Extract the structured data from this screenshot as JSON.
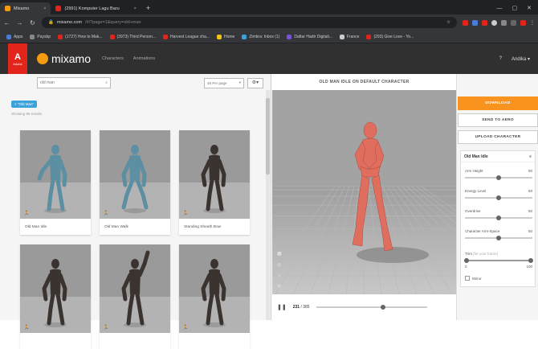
{
  "browser": {
    "tabs": [
      {
        "title": "Mixamo",
        "color": "#f39c12",
        "active": true
      },
      {
        "title": "(2991) Komputer Lagu Baru",
        "color": "#e1251b",
        "active": false
      }
    ],
    "url_host": "mixamo.com",
    "url_path": "/#/?page=1&query=old+man",
    "bookmarks": [
      {
        "label": "Apps",
        "color": "#4a7bd8"
      },
      {
        "label": "Paysbp",
        "color": "#888888"
      },
      {
        "label": "(1727) How to Mak...",
        "color": "#e1251b"
      },
      {
        "label": "(3973) Third Person...",
        "color": "#e1251b"
      },
      {
        "label": "Harvest League cha...",
        "color": "#e1251b"
      },
      {
        "label": "Home",
        "color": "#f1c40f"
      },
      {
        "label": "Zimbra: Inbox (1)",
        "color": "#3aa3db"
      },
      {
        "label": "Daftar Hadir Digitali...",
        "color": "#7b4fd8"
      },
      {
        "label": "France",
        "color": "#cccccc"
      },
      {
        "label": "(293) Give Love - Yo...",
        "color": "#e1251b"
      }
    ]
  },
  "app": {
    "adobe": "A",
    "adobe_sub": "Adobe",
    "logo": "mixamo",
    "nav": [
      "Characters",
      "Animations"
    ],
    "help": "?",
    "user": "Andika ▾"
  },
  "search": {
    "query": "old man",
    "per_page": "48 Per page",
    "tag": "× \"Old Man\"",
    "results": "Showing 96 results"
  },
  "cards": [
    {
      "label": "Old Man Idle",
      "figure": "blue",
      "pose": "idle"
    },
    {
      "label": "Old Man Walk",
      "figure": "blue",
      "pose": "walk"
    },
    {
      "label": "Standing Sheath Bow",
      "figure": "dark",
      "pose": "stand"
    },
    {
      "label": "",
      "figure": "dark",
      "pose": "stand"
    },
    {
      "label": "",
      "figure": "dark",
      "pose": "arm-up"
    },
    {
      "label": "",
      "figure": "dark",
      "pose": "stand"
    }
  ],
  "viewer": {
    "title": "OLD MAN IDLE ON DEFAULT CHARACTER",
    "frame_current": "231",
    "frame_total": "/ 385",
    "timeline_progress": 0.6
  },
  "side": {
    "download": "DOWNLOAD",
    "send": "SEND TO AERO",
    "upload": "UPLOAD CHARACTER",
    "panel_title": "Old Man Idle",
    "sliders": [
      {
        "label": "Arm Height",
        "value": "50",
        "pos": 0.5
      },
      {
        "label": "Energy Level",
        "value": "50",
        "pos": 0.5
      },
      {
        "label": "Overdrive",
        "value": "50",
        "pos": 0.5
      },
      {
        "label": "Character Arm-Space",
        "value": "50",
        "pos": 0.5
      }
    ],
    "trim_label": "Trim",
    "trim_sub": "(for your frame)",
    "trim_start": "0",
    "trim_end": "100",
    "mirror": "Mirror"
  },
  "colors": {
    "accent": "#f7931e",
    "tag": "#3aa3db",
    "figure_blue": "#5d8fa3",
    "figure_dark": "#3a3330",
    "figure_red": "#e06e5f"
  }
}
